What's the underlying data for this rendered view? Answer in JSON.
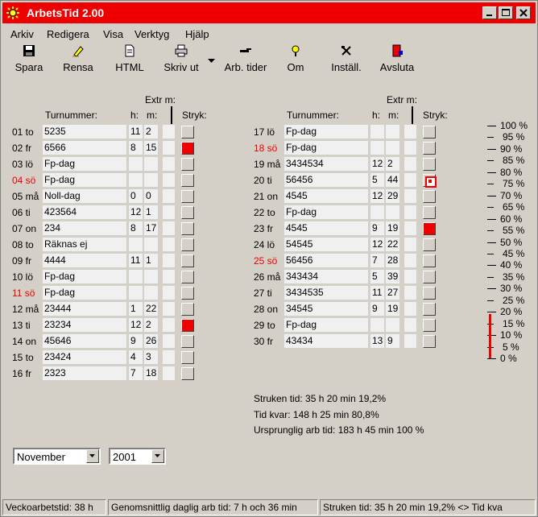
{
  "window": {
    "title": "ArbetsTid 2.00"
  },
  "menu": [
    "Arkiv",
    "Redigera",
    "Visa",
    "Verktyg",
    "Hjälp"
  ],
  "toolbar": [
    {
      "label": "Spara",
      "icon": "save-icon"
    },
    {
      "label": "Rensa",
      "icon": "clear-icon"
    },
    {
      "label": "HTML",
      "icon": "html-icon"
    },
    {
      "label": "Skriv ut",
      "icon": "print-icon"
    },
    {
      "label": "Arb. tider",
      "icon": "work-times-icon"
    },
    {
      "label": "Om",
      "icon": "about-icon"
    },
    {
      "label": "Inställ.",
      "icon": "settings-icon"
    },
    {
      "label": "Avsluta",
      "icon": "exit-icon"
    }
  ],
  "headers": {
    "extr": "Extr m:",
    "turnummer": "Turnummer:",
    "h": "h:",
    "m": "m:",
    "stryk": "Stryk:"
  },
  "days_left": [
    {
      "label": "01 to",
      "tur": "5235",
      "h": "11",
      "m": "2",
      "stryk": "off",
      "red": false
    },
    {
      "label": "02 fr",
      "tur": "6566",
      "h": "8",
      "m": "15",
      "stryk": "on",
      "red": false
    },
    {
      "label": "03 lö",
      "tur": "Fp-dag",
      "h": "",
      "m": "",
      "stryk": "off",
      "red": false
    },
    {
      "label": "04 sö",
      "tur": "Fp-dag",
      "h": "",
      "m": "",
      "stryk": "off",
      "red": true
    },
    {
      "label": "05 må",
      "tur": "Noll-dag",
      "h": "0",
      "m": "0",
      "stryk": "off",
      "red": false
    },
    {
      "label": "06 ti",
      "tur": "423564",
      "h": "12",
      "m": "1",
      "stryk": "off",
      "red": false
    },
    {
      "label": "07 on",
      "tur": "234",
      "h": "8",
      "m": "17",
      "stryk": "off",
      "red": false
    },
    {
      "label": "08 to",
      "tur": "Räknas ej",
      "h": "",
      "m": "",
      "stryk": "off",
      "red": false
    },
    {
      "label": "09 fr",
      "tur": "4444",
      "h": "11",
      "m": "1",
      "stryk": "off",
      "red": false
    },
    {
      "label": "10 lö",
      "tur": "Fp-dag",
      "h": "",
      "m": "",
      "stryk": "off",
      "red": false
    },
    {
      "label": "11 sö",
      "tur": "Fp-dag",
      "h": "",
      "m": "",
      "stryk": "off",
      "red": true
    },
    {
      "label": "12 må",
      "tur": "23444",
      "h": "1",
      "m": "22",
      "stryk": "off",
      "red": false
    },
    {
      "label": "13 ti",
      "tur": "23234",
      "h": "12",
      "m": "2",
      "stryk": "on",
      "red": false
    },
    {
      "label": "14 on",
      "tur": "45646",
      "h": "9",
      "m": "26",
      "stryk": "off",
      "red": false
    },
    {
      "label": "15 to",
      "tur": "23424",
      "h": "4",
      "m": "3",
      "stryk": "off",
      "red": false
    },
    {
      "label": "16 fr",
      "tur": "2323",
      "h": "7",
      "m": "18",
      "stryk": "off",
      "red": false
    }
  ],
  "days_right": [
    {
      "label": "17 lö",
      "tur": "Fp-dag",
      "h": "",
      "m": "",
      "stryk": "off",
      "red": false
    },
    {
      "label": "18 sö",
      "tur": "Fp-dag",
      "h": "",
      "m": "",
      "stryk": "off",
      "red": true
    },
    {
      "label": "19 må",
      "tur": "3434534",
      "h": "12",
      "m": "2",
      "stryk": "off",
      "red": false
    },
    {
      "label": "20 ti",
      "tur": "56456",
      "h": "5",
      "m": "44",
      "stryk": "frame",
      "red": false
    },
    {
      "label": "21 on",
      "tur": "4545",
      "h": "12",
      "m": "29",
      "stryk": "off",
      "red": false
    },
    {
      "label": "22 to",
      "tur": "Fp-dag",
      "h": "",
      "m": "",
      "stryk": "off",
      "red": false
    },
    {
      "label": "23 fr",
      "tur": "4545",
      "h": "9",
      "m": "19",
      "stryk": "on",
      "red": false
    },
    {
      "label": "24 lö",
      "tur": "54545",
      "h": "12",
      "m": "22",
      "stryk": "off",
      "red": false
    },
    {
      "label": "25 sö",
      "tur": "56456",
      "h": "7",
      "m": "28",
      "stryk": "off",
      "red": true
    },
    {
      "label": "26 må",
      "tur": "343434",
      "h": "5",
      "m": "39",
      "stryk": "off",
      "red": false
    },
    {
      "label": "27 ti",
      "tur": "3434535",
      "h": "11",
      "m": "27",
      "stryk": "off",
      "red": false
    },
    {
      "label": "28 on",
      "tur": "34545",
      "h": "9",
      "m": "19",
      "stryk": "off",
      "red": false
    },
    {
      "label": "29 to",
      "tur": "Fp-dag",
      "h": "",
      "m": "",
      "stryk": "off",
      "red": false
    },
    {
      "label": "30 fr",
      "tur": "43434",
      "h": "13",
      "m": "9",
      "stryk": "off",
      "red": false
    }
  ],
  "scale": {
    "labels": [
      "100 %",
      "95 %",
      "90 %",
      "85 %",
      "80 %",
      "75 %",
      "70 %",
      "65 %",
      "60 %",
      "55 %",
      "50 %",
      "45 %",
      "40 %",
      "35 %",
      "30 %",
      "25 %",
      "20 %",
      "15 %",
      "10 %",
      "5 %",
      "0 %"
    ],
    "indicator_percent": 19.2,
    "indicator_color": "#ee0000"
  },
  "summary": [
    "Struken tid: 35 h  20 min  19,2%",
    "Tid kvar:  148 h 25 min  80,8%",
    "Ursprunglig arb tid: 183 h 45 min 100 %"
  ],
  "month_select": {
    "value": "November"
  },
  "year_select": {
    "value": "2001"
  },
  "statusbar": [
    "Veckoarbetstid: 38 h",
    "Genomsnittlig daglig arb tid: 7 h och 36 min",
    "Struken tid: 35 h  20 min  19,2% <> Tid kva"
  ]
}
